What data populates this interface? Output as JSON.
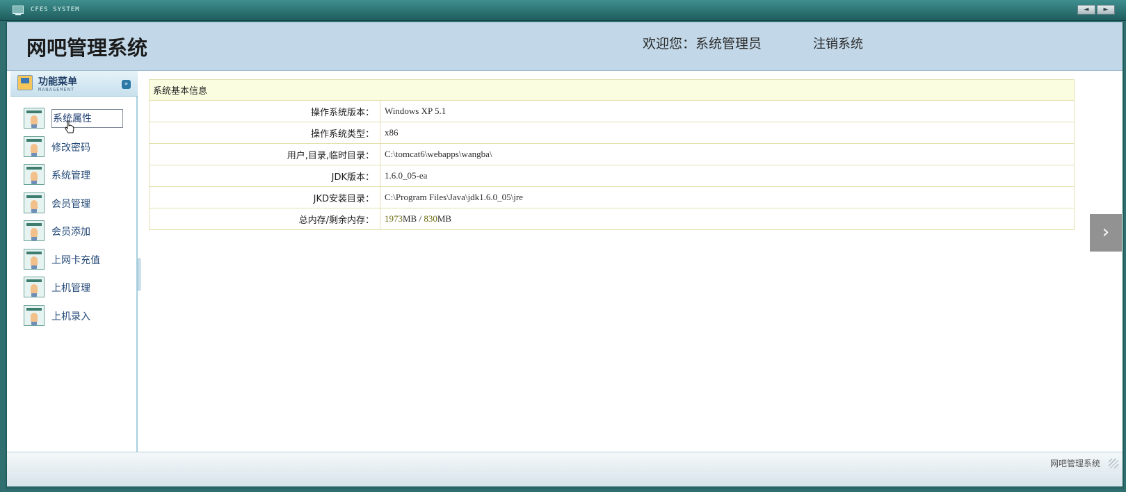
{
  "window": {
    "title": "CFES SYSTEM",
    "nav_prev": "◄",
    "nav_next": "►"
  },
  "header": {
    "app_title": "网吧管理系统",
    "welcome": "欢迎您：系统管理员",
    "logout": "注销系统"
  },
  "sidebar": {
    "menu_title": "功能菜单",
    "menu_subtitle": "MANAGEMENT",
    "collapse_icon": "double-chevron-down-icon",
    "items": [
      {
        "label": "系统属性",
        "selected": true
      },
      {
        "label": "修改密码"
      },
      {
        "label": "系统管理"
      },
      {
        "label": "会员管理"
      },
      {
        "label": "会员添加"
      },
      {
        "label": "上网卡充值"
      },
      {
        "label": "上机管理"
      },
      {
        "label": "上机录入"
      }
    ]
  },
  "main": {
    "panel_title": "系统基本信息",
    "rows": [
      {
        "label": "操作系统版本：",
        "value": "Windows XP  5.1"
      },
      {
        "label": "操作系统类型：",
        "value": "x86"
      },
      {
        "label": "用户,目录,临时目录：",
        "value": "C:\\tomcat6\\webapps\\wangba\\"
      },
      {
        "label": "JDK版本：",
        "value": "1.6.0_05-ea"
      },
      {
        "label": "JKD安装目录：",
        "value": "C:\\Program Files\\Java\\jdk1.6.0_05\\jre"
      },
      {
        "label": "总内存/剩余内存：",
        "total_mem": "1973",
        "mem_sep": "MB  /  ",
        "free_mem": "830",
        "mem_unit": "MB"
      }
    ]
  },
  "footer": {
    "text": "网吧管理系统"
  }
}
